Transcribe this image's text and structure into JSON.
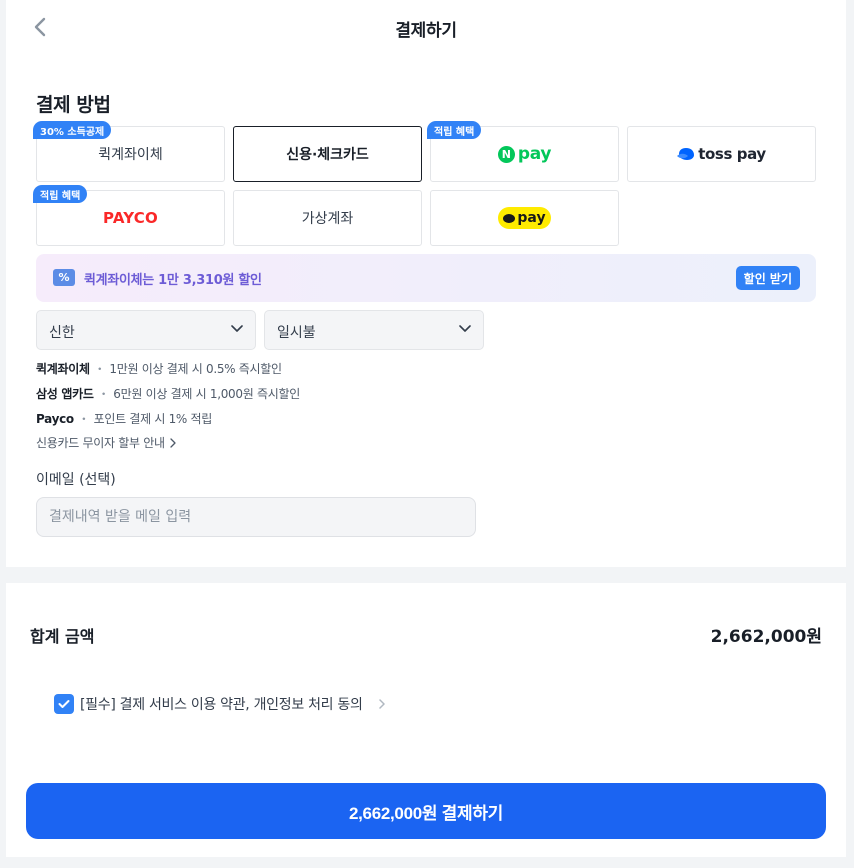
{
  "header": {
    "title": "결제하기"
  },
  "payment": {
    "section_title": "결제 방법",
    "methods": [
      {
        "label": "퀵계좌이체",
        "badge": "30% 소득공제"
      },
      {
        "label": "신용·체크카드",
        "selected": true
      },
      {
        "label": "pay",
        "logo_letter": "N",
        "badge": "적립 혜택"
      },
      {
        "label": "toss pay"
      },
      {
        "label": "PAYCO",
        "badge": "적립 혜택"
      },
      {
        "label": "가상계좌"
      },
      {
        "label": "pay"
      }
    ]
  },
  "promo": {
    "icon_text": "%",
    "text": "퀵계좌이체는 1만 3,310원 할인",
    "button": "할인 받기"
  },
  "card_select": {
    "value": "신한"
  },
  "installment_select": {
    "value": "일시불"
  },
  "benefits": [
    {
      "name": "퀵계좌이체",
      "sep": "・",
      "desc": "1만원 이상 결제 시 0.5% 즉시할인"
    },
    {
      "name": "삼성 앱카드",
      "sep": "・",
      "desc": "6만원 이상 결제 시 1,000원 즉시할인"
    },
    {
      "name": "Payco",
      "sep": "・",
      "desc": "포인트 결제 시 1% 적립"
    }
  ],
  "installment_link": "신용카드 무이자 할부 안내",
  "email": {
    "label": "이메일  (선택)",
    "placeholder": "결제내역 받을 메일 입력"
  },
  "total": {
    "label": "합계 금액",
    "value": "2,662,000원"
  },
  "agreement": {
    "text": "[필수] 결제 서비스 이용 약관, 개인정보 처리 동의",
    "checked": true
  },
  "pay_button": "2,662,000원 결제하기",
  "colors": {
    "primary": "#3182f6",
    "pay_button": "#1b64f2",
    "npay": "#03c75a",
    "payco": "#fa2828",
    "kakao": "#ffeb00"
  }
}
